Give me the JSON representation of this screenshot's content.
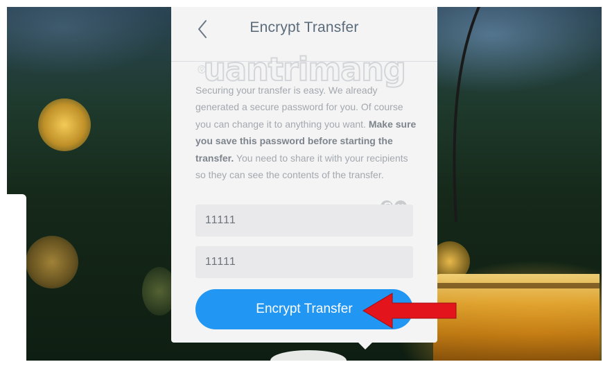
{
  "header": {
    "title": "Encrypt Transfer"
  },
  "watermark": {
    "text": "uantrimang"
  },
  "description": {
    "part1": "Securing your transfer is easy. We already generated a secure password for you. Of course you can change it to anything you want. ",
    "bold": "Make sure you save this password before starting the transfer.",
    "part2": " You need to share it with your recipients so they can see the contents of the transfer."
  },
  "password": {
    "value": "11111",
    "confirm_value": "11111"
  },
  "actions": {
    "encrypt_label": "Encrypt Transfer"
  },
  "icons": {
    "back": "chevron-left-icon",
    "copy": "copy-icon",
    "clear": "close-icon"
  },
  "colors": {
    "accent": "#2196f3",
    "arrow": "#e3141b",
    "card": "#f4f4f5"
  }
}
